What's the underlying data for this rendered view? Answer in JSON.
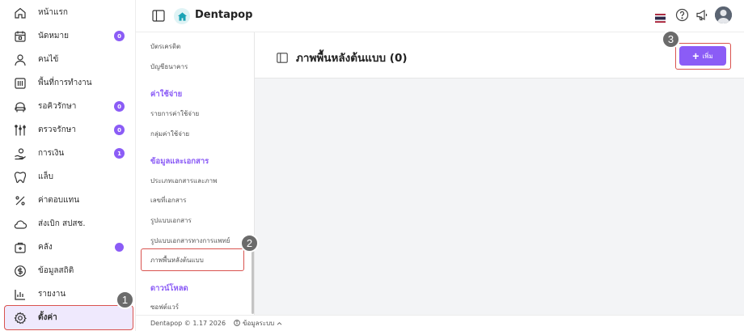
{
  "sidebar": {
    "items": [
      {
        "label": "หน้าแรก",
        "icon": "home-icon"
      },
      {
        "label": "นัดหมาย",
        "icon": "calendar-icon",
        "badge": "0"
      },
      {
        "label": "คนไข้",
        "icon": "user-icon"
      },
      {
        "label": "พื้นที่การทำงาน",
        "icon": "workspace-icon"
      },
      {
        "label": "รอคิวรักษา",
        "icon": "chair-icon",
        "badge": "0"
      },
      {
        "label": "ตรวจรักษา",
        "icon": "tools-icon",
        "badge": "0"
      },
      {
        "label": "การเงิน",
        "icon": "finance-icon",
        "badge": "1"
      },
      {
        "label": "แล็บ",
        "icon": "tooth-icon"
      },
      {
        "label": "ค่าตอบแทน",
        "icon": "percent-icon"
      },
      {
        "label": "ส่งเบิก สปสช.",
        "icon": "cloud-icon"
      },
      {
        "label": "คลัง",
        "icon": "inventory-icon",
        "dot": true
      },
      {
        "label": "ข้อมูลสถิติ",
        "icon": "stats-icon"
      },
      {
        "label": "รายงาน",
        "icon": "report-icon"
      }
    ],
    "active": {
      "label": "ตั้งค่า",
      "icon": "gear-icon"
    }
  },
  "header": {
    "brand": "Dentapop"
  },
  "submenu": {
    "items_top": [
      "บัตรเครดิต",
      "บัญชีธนาคาร"
    ],
    "section_expense": "ค่าใช้จ่าย",
    "expense_items": [
      "รายการค่าใช้จ่าย",
      "กลุ่มค่าใช้จ่าย"
    ],
    "section_docs": "ข้อมูลและเอกสาร",
    "doc_items": [
      "ประเภทเอกสารและภาพ",
      "เลขที่เอกสาร",
      "รูปแบบเอกสาร",
      "รูปแบบเอกสารทางการแพทย์"
    ],
    "active_item": "ภาพพื้นหลังต้นแบบ",
    "section_download": "ดาวน์โหลด",
    "download_items": [
      "ซอฟต์แวร์"
    ]
  },
  "main": {
    "title": "ภาพพื้นหลังต้นแบบ (0)",
    "add_label": "เพิ่ม"
  },
  "footer": {
    "copyright": "Dentapop © 1.17 2026",
    "system_info": "ข้อมูลระบบ"
  },
  "markers": [
    "1",
    "2",
    "3"
  ],
  "colors": {
    "accent": "#8b5cf6",
    "highlight": "#d9534f"
  }
}
